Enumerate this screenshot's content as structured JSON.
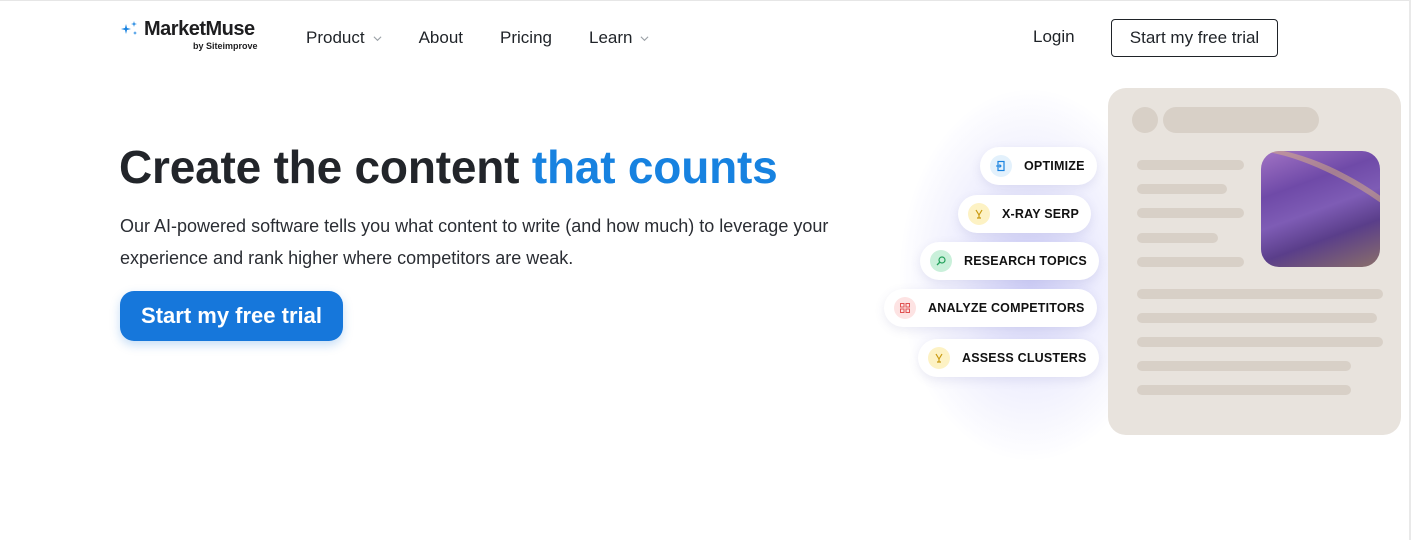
{
  "header": {
    "logo_name": "MarketMuse",
    "logo_byline": "by Siteimprove",
    "nav": [
      {
        "label": "Product",
        "has_dropdown": true
      },
      {
        "label": "About",
        "has_dropdown": false
      },
      {
        "label": "Pricing",
        "has_dropdown": false
      },
      {
        "label": "Learn",
        "has_dropdown": true
      }
    ],
    "login_label": "Login",
    "cta_label": "Start my free trial"
  },
  "hero": {
    "title_main": "Create the content ",
    "title_accent": "that counts",
    "subtitle": "Our AI-powered software tells you what content to write (and how much) to leverage your experience and rank higher where competitors are weak.",
    "cta_label": "Start my free trial"
  },
  "features": [
    {
      "label": "OPTIMIZE",
      "icon": "optimize-icon",
      "color": "#e3f1fc",
      "fg": "#1782e0"
    },
    {
      "label": "X-RAY SERP",
      "icon": "xray-icon",
      "color": "#fdf2c4",
      "fg": "#c99a10"
    },
    {
      "label": "RESEARCH TOPICS",
      "icon": "research-icon",
      "color": "#c9f0da",
      "fg": "#22a05a"
    },
    {
      "label": "ANALYZE COMPETITORS",
      "icon": "grid-icon",
      "color": "#fde3e3",
      "fg": "#e05050"
    },
    {
      "label": "ASSESS CLUSTERS",
      "icon": "cluster-icon",
      "color": "#fdf2c4",
      "fg": "#c99a10"
    }
  ],
  "colors": {
    "accent": "#1782e0",
    "cta": "#1677db",
    "card": "#e8e3dd"
  }
}
